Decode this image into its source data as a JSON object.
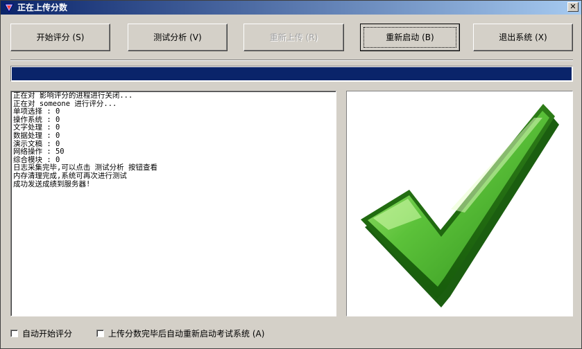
{
  "window": {
    "title": "正在上传分数",
    "close_glyph": "✕"
  },
  "toolbar": {
    "buttons": [
      {
        "label": "开始评分 (S)",
        "enabled": true
      },
      {
        "label": "测试分析 (V)",
        "enabled": true
      },
      {
        "label": "重新上传 (R)",
        "enabled": false
      },
      {
        "label": "重新启动 (B)",
        "enabled": true,
        "focused": true
      },
      {
        "label": "退出系统 (X)",
        "enabled": true
      }
    ]
  },
  "progress": {
    "value_percent": 100,
    "color": "#0a246a"
  },
  "log": {
    "lines": [
      "正在对 影响评分的进程进行关闭...",
      "正在对 someone 进行评分...",
      "单项选择 : 0",
      "操作系统 : 0",
      "文字处理 : 0",
      "数据处理 : 0",
      "演示文稿 : 0",
      "网络操作 : 50",
      "综合模块 : 0",
      "日志采集完毕,可以点击 测试分析 按钮查看",
      "内存清理完成,系统可再次进行测试",
      "成功发送成绩到服务器!"
    ]
  },
  "status_image": {
    "icon": "green-checkmark-icon",
    "color": "#3aa52a"
  },
  "options": {
    "auto_start_label": "自动开始评分",
    "auto_restart_label": "上传分数完毕后自动重新启动考试系统 (A)"
  }
}
